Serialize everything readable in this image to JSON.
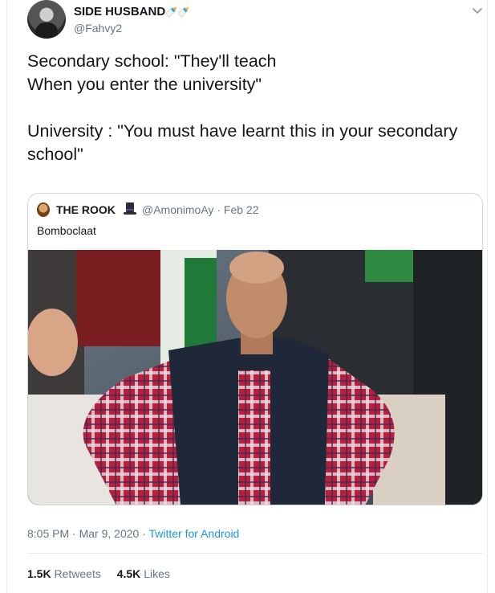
{
  "tweet": {
    "author": {
      "name": "SIDE HUSBAND",
      "badges": "🍼🍼",
      "handle": "@Fahvy2"
    },
    "text": "Secondary school: \"They'll teach\nWhen you enter the university\"\n\nUniversity : \"You must have learnt this in your secondary school\"",
    "quoted": {
      "author_name": "THE ROOK",
      "handle": "@AmonimoAy",
      "date": "Feb 22",
      "separator": "·",
      "text": "Bomboclaat",
      "media_description_icon": "photo-icon"
    },
    "meta": {
      "time": "8:05 PM",
      "date": "Mar 9, 2020",
      "source": "Twitter for Android",
      "separator": "·"
    },
    "stats": {
      "retweets": "1.5K",
      "retweets_label": "Retweets",
      "likes": "4.5K",
      "likes_label": "Likes"
    }
  },
  "colors": {
    "link": "#1b95e0",
    "muted": "#657786",
    "border": "#e6ecf0",
    "text": "#14171a"
  },
  "icons": {
    "menu": "chevron-down-icon"
  }
}
